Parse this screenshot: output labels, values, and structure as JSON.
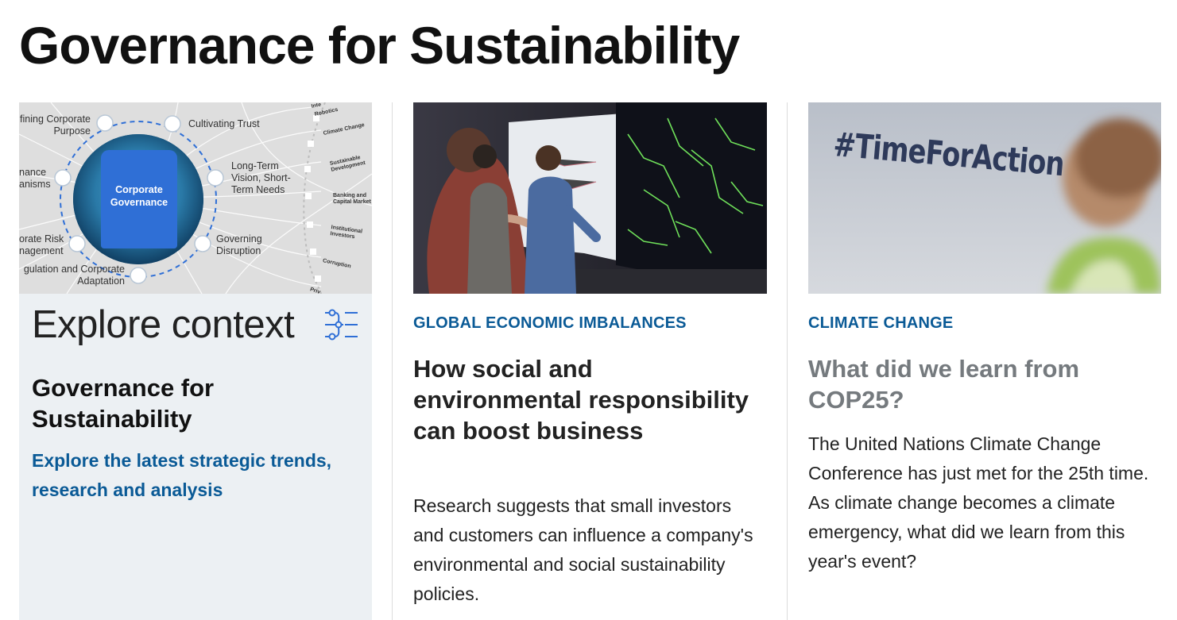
{
  "page": {
    "title": "Governance for Sustainability"
  },
  "context_card": {
    "diagram": {
      "center_label_1": "Corporate",
      "center_label_2": "Governance",
      "nodes": [
        {
          "line1": "fining Corporate",
          "line2": "Purpose"
        },
        {
          "line1": "Cultivating Trust",
          "line2": ""
        },
        {
          "line1": "Long-Term",
          "line2": "Vision, Short-",
          "line3": "Term Needs"
        },
        {
          "line1": "Governing",
          "line2": "Disruption"
        },
        {
          "line1": "gulation and Corporate",
          "line2": "Adaptation"
        },
        {
          "line1": "orate Risk",
          "line2": "nagement"
        },
        {
          "line1": "nance",
          "line2": "anisms"
        }
      ],
      "outer_topics": [
        "Robotics",
        "Climate Change",
        "Sustainable Development",
        "Banking and Capital Market",
        "Institutional Investors",
        "Corruption",
        "Priv"
      ],
      "outer_topic_top": "Inte"
    },
    "heading": "Explore context",
    "subtitle": "Governance for Sustainability",
    "link": "Explore the latest strategic trends, research and analysis",
    "icon": "network-nodes-icon"
  },
  "articles": [
    {
      "category": "GLOBAL ECONOMIC IMBALANCES",
      "headline": "How social and environmental responsibility can boost business",
      "summary": "Research suggests that small investors and customers can influence a company's environmental and social sustainability policies."
    },
    {
      "category": "CLIMATE CHANGE",
      "headline": "What did we learn from COP25?",
      "summary": "The United Nations Climate Change Conference has just met for the 25th time. As climate change becomes a climate emergency, what did we learn from this year's event?",
      "image_text": "#TimeForAction"
    }
  ],
  "colors": {
    "accent": "#0a5a96",
    "panel_bg": "#ecf0f3",
    "badge": "#2f6fd6",
    "headline_grey": "#757a7e"
  }
}
